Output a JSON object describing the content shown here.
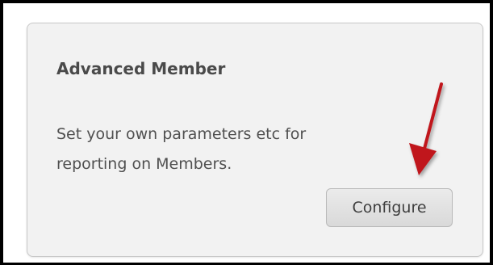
{
  "card": {
    "title": "Advanced Member",
    "description_line1": "Set your own parameters etc for",
    "description_line2": "reporting on Members.",
    "configure_label": "Configure"
  },
  "colors": {
    "annotation_arrow": "#c0161a",
    "card_background": "#f2f2f2",
    "frame_border": "#000000"
  }
}
